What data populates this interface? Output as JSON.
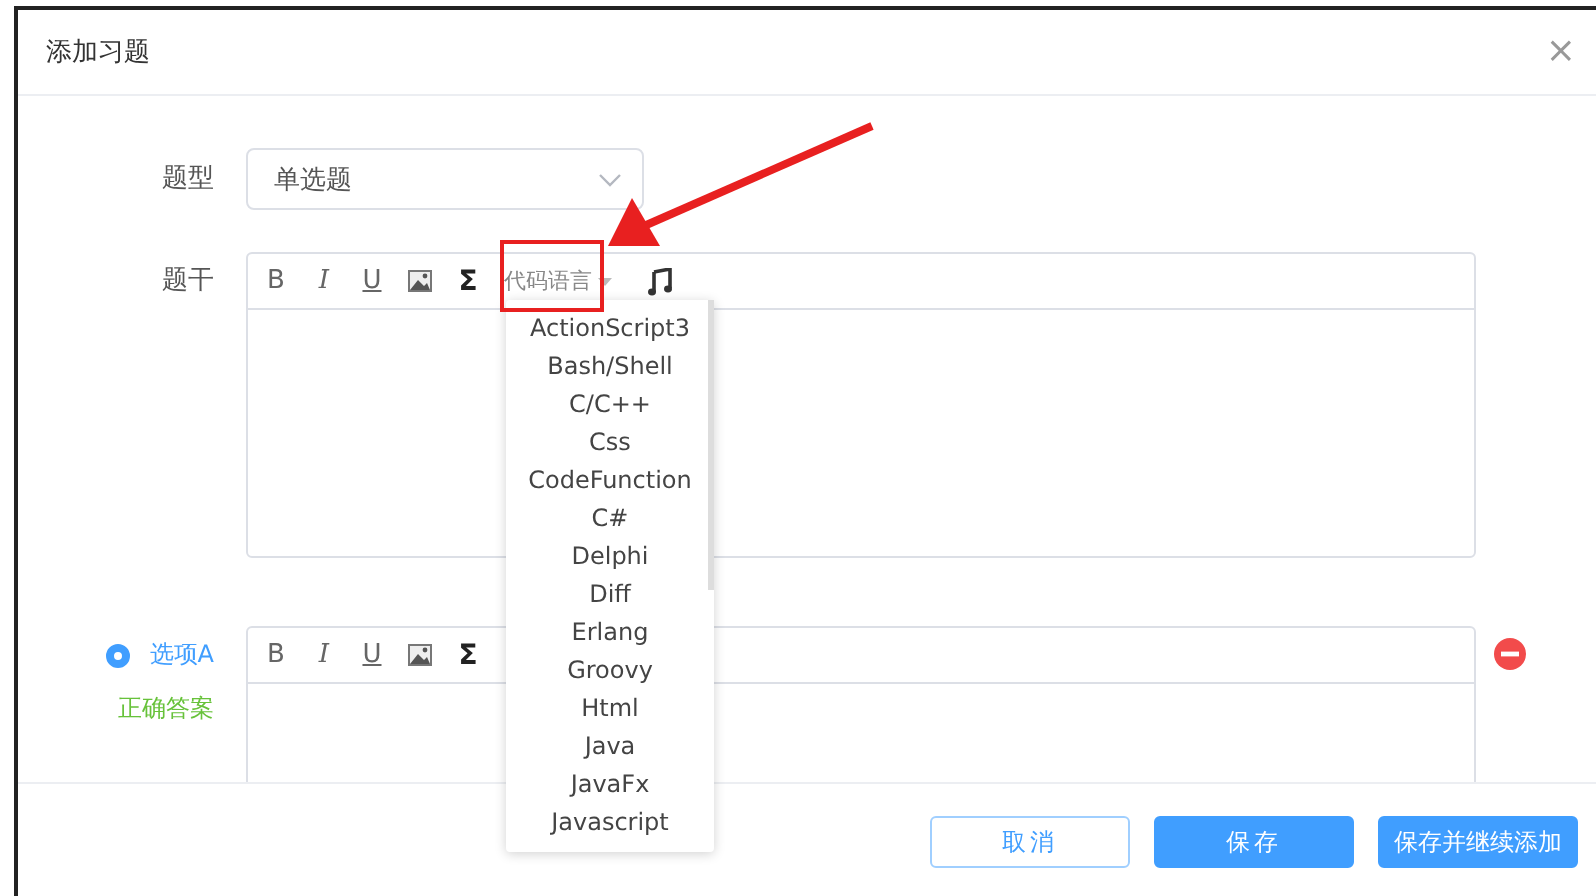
{
  "dialog": {
    "title": "添加习题",
    "close": "×"
  },
  "question_type": {
    "label": "题型",
    "value": "单选题"
  },
  "stem": {
    "label": "题干",
    "toolbar": [
      {
        "kind": "bold",
        "label": "B"
      },
      {
        "kind": "italic",
        "label": "I"
      },
      {
        "kind": "underline",
        "label": "U"
      },
      {
        "kind": "image"
      },
      {
        "kind": "formula",
        "label": "Σ"
      },
      {
        "kind": "dropdown",
        "label": "代码语言"
      },
      {
        "kind": "music"
      }
    ]
  },
  "options": [
    {
      "label": "选项A",
      "selected": true,
      "correct_answer": "正确答案",
      "toolbar": [
        {
          "kind": "bold",
          "label": "B"
        },
        {
          "kind": "italic",
          "label": "I"
        },
        {
          "kind": "underline",
          "label": "U"
        },
        {
          "kind": "image"
        },
        {
          "kind": "formula",
          "label": "Σ"
        }
      ]
    }
  ],
  "language_menu": {
    "items": [
      "ActionScript3",
      "Bash/Shell",
      "C/C++",
      "Css",
      "CodeFunction",
      "C#",
      "Delphi",
      "Diff",
      "Erlang",
      "Groovy",
      "Html",
      "Java",
      "JavaFx",
      "Javascript"
    ]
  },
  "buttons": [
    {
      "label": "取消",
      "kind": "secondary"
    },
    {
      "label": "保存",
      "kind": "primary"
    },
    {
      "label": "保存并继续添加",
      "kind": "primary"
    }
  ]
}
